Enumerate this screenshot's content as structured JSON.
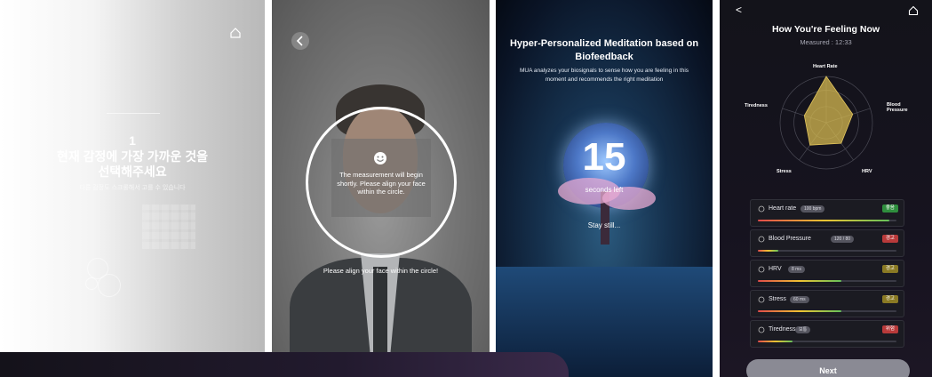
{
  "panel1": {
    "question_number": "1",
    "question_text": "현재 감정에 가장 가까운 것을\n선택해주세요",
    "sub_text": "다른 감정도 스크롤해서 고를 수 있습니다",
    "icons": [
      "home-icon"
    ]
  },
  "panel2": {
    "overlay_message": "The measurement will begin shortly. Please align your face within the circle.",
    "instruction": "Please align your face within the circle!",
    "icons": [
      "back-icon",
      "smile-icon"
    ]
  },
  "panel3": {
    "title": "Hyper-Personalized Meditation based on Biofeedback",
    "description": "MUA analyzes your biosignals to sense how you are feeling in this moment and recommends the right meditation",
    "countdown": "15",
    "countdown_label": "seconds left",
    "status": "Stay still..."
  },
  "panel4": {
    "back": "<",
    "title": "How You're Feeling Now",
    "measured": "Measured : 12:33",
    "radar_labels": {
      "top": "Heart Rate",
      "right": "Blood\nPressure",
      "bottom_right": "HRV",
      "bottom_left": "Stress",
      "left": "Tiredness"
    },
    "metrics": [
      {
        "label": "Heart rate",
        "pill": "100 bpm",
        "badge": "좋음",
        "badge_color": "#2f8f3e",
        "level": 0.95,
        "icon": "heart-icon"
      },
      {
        "label": "Blood Pressure",
        "pill": "120 / 80",
        "badge": "경고",
        "badge_color": "#b83a3a",
        "level": 0.15,
        "icon": "drop-icon"
      },
      {
        "label": "HRV",
        "pill": "8 ms",
        "badge": "경고",
        "badge_color": "#8a7a24",
        "level": 0.6,
        "icon": "pulse-icon"
      },
      {
        "label": "Stress",
        "pill": "60 ms",
        "badge": "경고",
        "badge_color": "#8a7a24",
        "level": 0.6,
        "icon": "smile-icon"
      },
      {
        "label": "Tiredness",
        "pill": "보통",
        "badge": "위험",
        "badge_color": "#b83a3a",
        "level": 0.25,
        "icon": "eye-icon"
      }
    ],
    "radar_values": [
      1.0,
      0.6,
      0.55,
      0.6,
      0.5
    ],
    "next_label": "Next"
  }
}
